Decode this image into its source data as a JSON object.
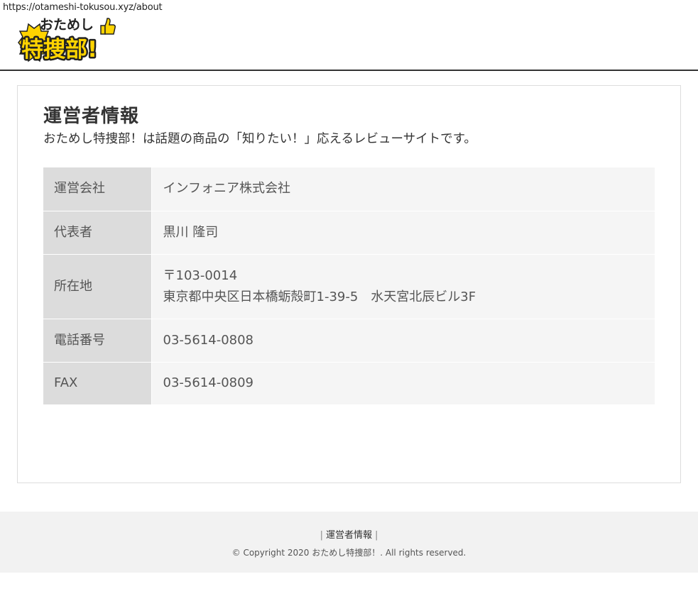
{
  "browser": {
    "url": "https://otameshi-tokusou.xyz/about"
  },
  "header": {
    "logo_top": "おためし",
    "logo_bottom": "特捜部!"
  },
  "main": {
    "title": "運営者情報",
    "lead": "おためし特捜部！は話題の商品の「知りたい！」応えるレビューサイトです。",
    "rows": [
      {
        "label": "運営会社",
        "value": "インフォニア株式会社"
      },
      {
        "label": "代表者",
        "value": "黒川 隆司"
      },
      {
        "label": "所在地",
        "value_lines": [
          "〒103-0014",
          "東京都中央区日本橋蛎殻町1-39-5　水天宮北辰ビル3F"
        ]
      },
      {
        "label": "電話番号",
        "value": "03-5614-0808"
      },
      {
        "label": "FAX",
        "value": "03-5614-0809"
      }
    ]
  },
  "footer": {
    "nav_separator": "|",
    "nav_link": "運営者情報",
    "copyright": "© Copyright 2020 おためし特捜部！. All rights reserved."
  },
  "colors": {
    "logo_yellow": "#ffd400",
    "logo_dark": "#222222",
    "header_rule": "#333333",
    "th_bg": "#dcdcdc",
    "td_bg": "#f5f5f5",
    "footer_bg": "#f2f2f2"
  }
}
